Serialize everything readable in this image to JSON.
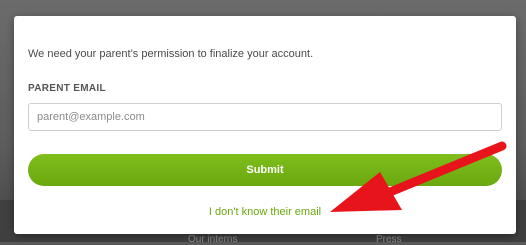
{
  "modal": {
    "message": "We need your parent’s permission to finalize your account.",
    "email_label": "PARENT EMAIL",
    "email_placeholder": "parent@example.com",
    "email_value": "",
    "submit_label": "Submit",
    "dont_know_link": "I don't know their email"
  },
  "background": {
    "links": [
      "Our interns",
      "Press"
    ]
  },
  "colors": {
    "accent_green": "#6aa80f",
    "annotation_arrow": "#e8141b"
  },
  "annotation": {
    "icon": "red-arrow-icon"
  }
}
